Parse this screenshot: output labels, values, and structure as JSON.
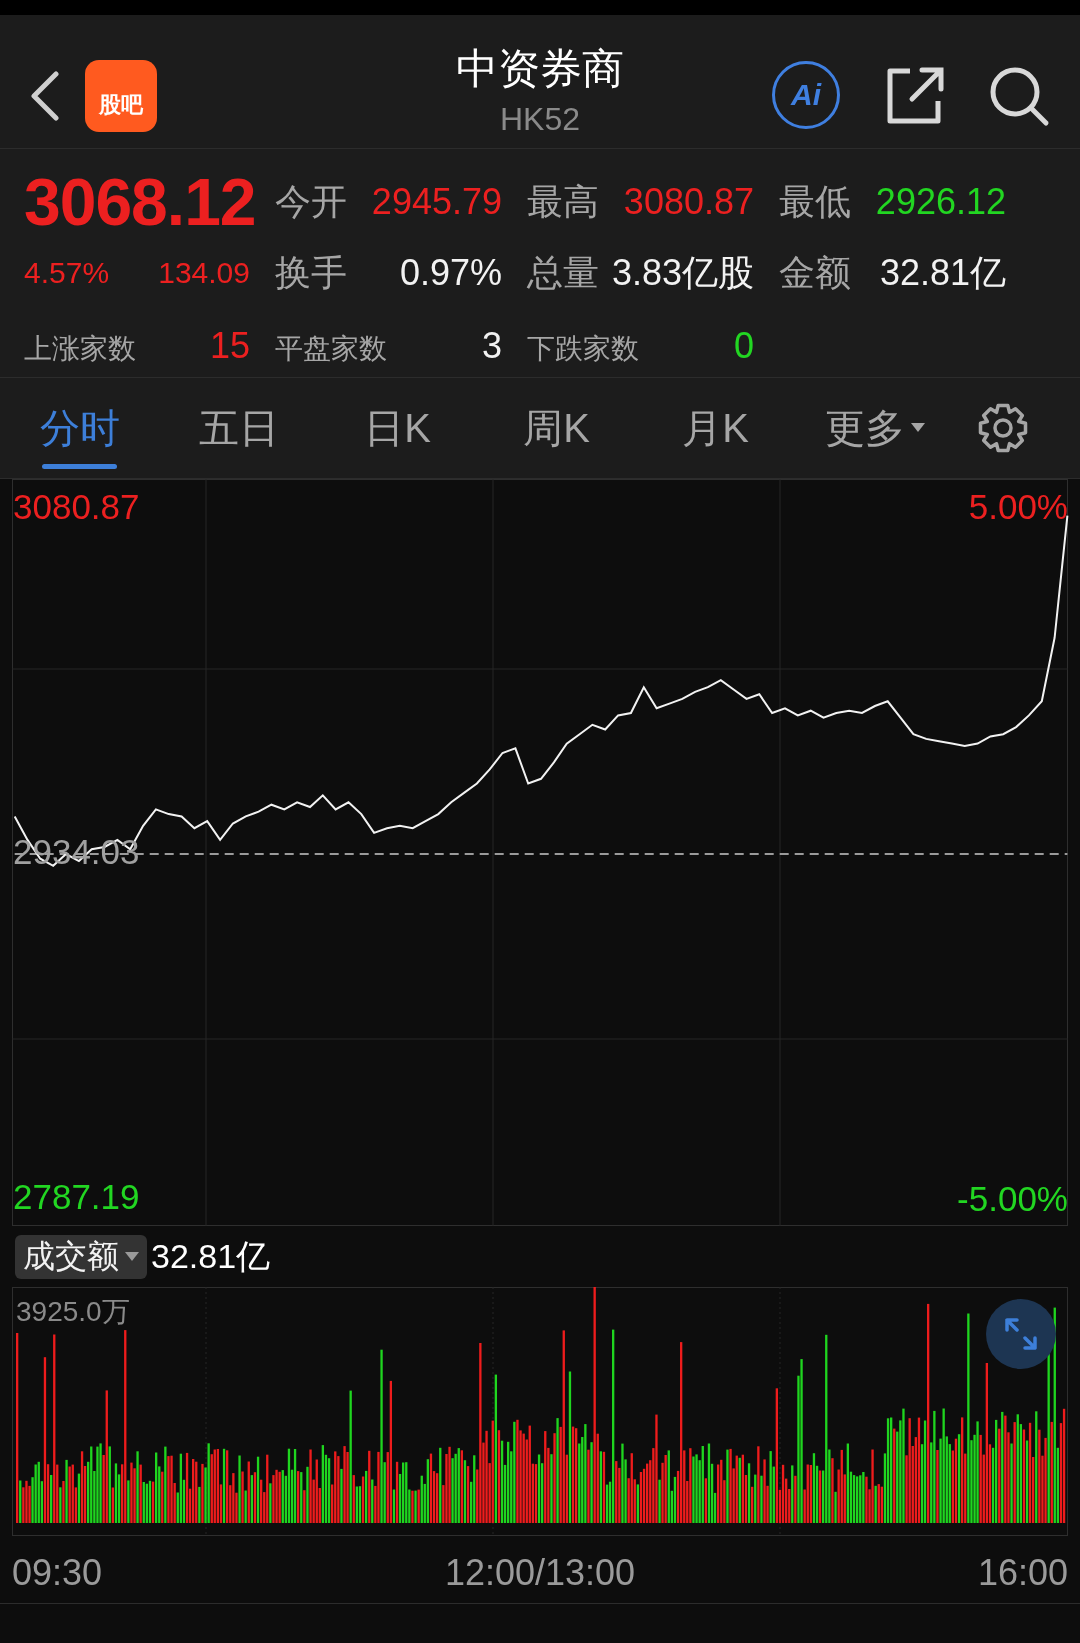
{
  "header": {
    "title": "中资券商",
    "code": "HK52",
    "badge": "股吧",
    "ai_label": "Ai"
  },
  "quote": {
    "price": "3068.12",
    "change_pct": "4.57%",
    "change": "134.09",
    "color": "#ec2020",
    "stats": [
      {
        "label": "今开",
        "value": "2945.79",
        "color": "#ec2020"
      },
      {
        "label": "最高",
        "value": "3080.87",
        "color": "#ec2020"
      },
      {
        "label": "最低",
        "value": "2926.12",
        "color": "#22d622"
      },
      {
        "label": "换手",
        "value": "0.97%",
        "color": "#f2f2f2"
      },
      {
        "label": "总量",
        "value": "3.83亿股",
        "color": "#f2f2f2"
      },
      {
        "label": "金额",
        "value": "32.81亿",
        "color": "#f2f2f2"
      }
    ],
    "breadth": [
      {
        "label": "上涨家数",
        "value": "15",
        "color": "#ec2020"
      },
      {
        "label": "平盘家数",
        "value": "3",
        "color": "#f2f2f2"
      },
      {
        "label": "下跌家数",
        "value": "0",
        "color": "#22d622"
      }
    ]
  },
  "tabs": [
    {
      "label": "分时",
      "selected": true,
      "kind": "tab"
    },
    {
      "label": "五日",
      "selected": false,
      "kind": "tab"
    },
    {
      "label": "日K",
      "selected": false,
      "kind": "tab"
    },
    {
      "label": "周K",
      "selected": false,
      "kind": "tab"
    },
    {
      "label": "月K",
      "selected": false,
      "kind": "tab"
    },
    {
      "label": "更多",
      "selected": false,
      "kind": "dropdown"
    }
  ],
  "price_chart": {
    "top_pct": "5.00%",
    "bottom_pct": "-5.00%",
    "chart_data": {
      "type": "line",
      "ylim": [
        2775.7,
        3093.6
      ],
      "yticks": [
        {
          "value": 3080.87,
          "label": "3080.87"
        },
        {
          "value": 2934.03,
          "label": "2934.03"
        },
        {
          "value": 2787.19,
          "label": "2787.19"
        }
      ],
      "series": [
        {
          "color": "#9a9a9a",
          "line_style": "dashed",
          "values": [
            2934,
            2934,
            2934,
            2934,
            2934,
            2934,
            2934,
            2934,
            2934,
            2934,
            2934,
            2934,
            2934,
            2934,
            2934,
            2934,
            2934,
            2934,
            2934,
            2934,
            2934,
            2934,
            2934,
            2934,
            2934,
            2934,
            2934,
            2934,
            2934,
            2934,
            2934,
            2934,
            2934,
            2934,
            2934,
            2934,
            2934,
            2934,
            2934,
            2934,
            2934,
            2934,
            2934,
            2934,
            2934,
            2934,
            2934,
            2934,
            2934,
            2934,
            2934,
            2934,
            2934,
            2934,
            2934,
            2934,
            2934,
            2934,
            2934,
            2934,
            2934,
            2934,
            2934,
            2934,
            2934,
            2934,
            2934,
            2934,
            2934,
            2934,
            2934,
            2934,
            2934,
            2934,
            2934,
            2934,
            2934,
            2934,
            2934,
            2934,
            2934,
            2934,
            2934
          ]
        },
        {
          "color": "#f2f2f2",
          "line_style": "solid",
          "values": [
            2950,
            2940,
            2932,
            2929,
            2934,
            2931,
            2936,
            2937,
            2940,
            2936,
            2946,
            2953,
            2951,
            2950,
            2945,
            2948,
            2940,
            2947,
            2950,
            2952,
            2955,
            2953,
            2956,
            2954,
            2959,
            2953,
            2956,
            2951,
            2943,
            2945,
            2946,
            2945,
            2948,
            2951,
            2956,
            2960,
            2964,
            2970,
            2977,
            2979,
            2964,
            2966,
            2973,
            2981,
            2985,
            2989,
            2987,
            2993,
            2994,
            3005,
            2996,
            2998,
            3000,
            3003,
            3005,
            3008,
            3004,
            3000,
            3002,
            2994,
            2996,
            2993,
            2995,
            2992,
            2994,
            2995,
            2994,
            2997,
            2999,
            2992,
            2985,
            2983,
            2982,
            2981,
            2980,
            2981,
            2984,
            2985,
            2988,
            2993,
            2999,
            3026,
            3078
          ]
        }
      ]
    }
  },
  "volume": {
    "selector": "成交额",
    "total": "32.81亿",
    "max": "3925.0万"
  },
  "time_axis": [
    "09:30",
    "12:00/13:00",
    "16:00"
  ]
}
